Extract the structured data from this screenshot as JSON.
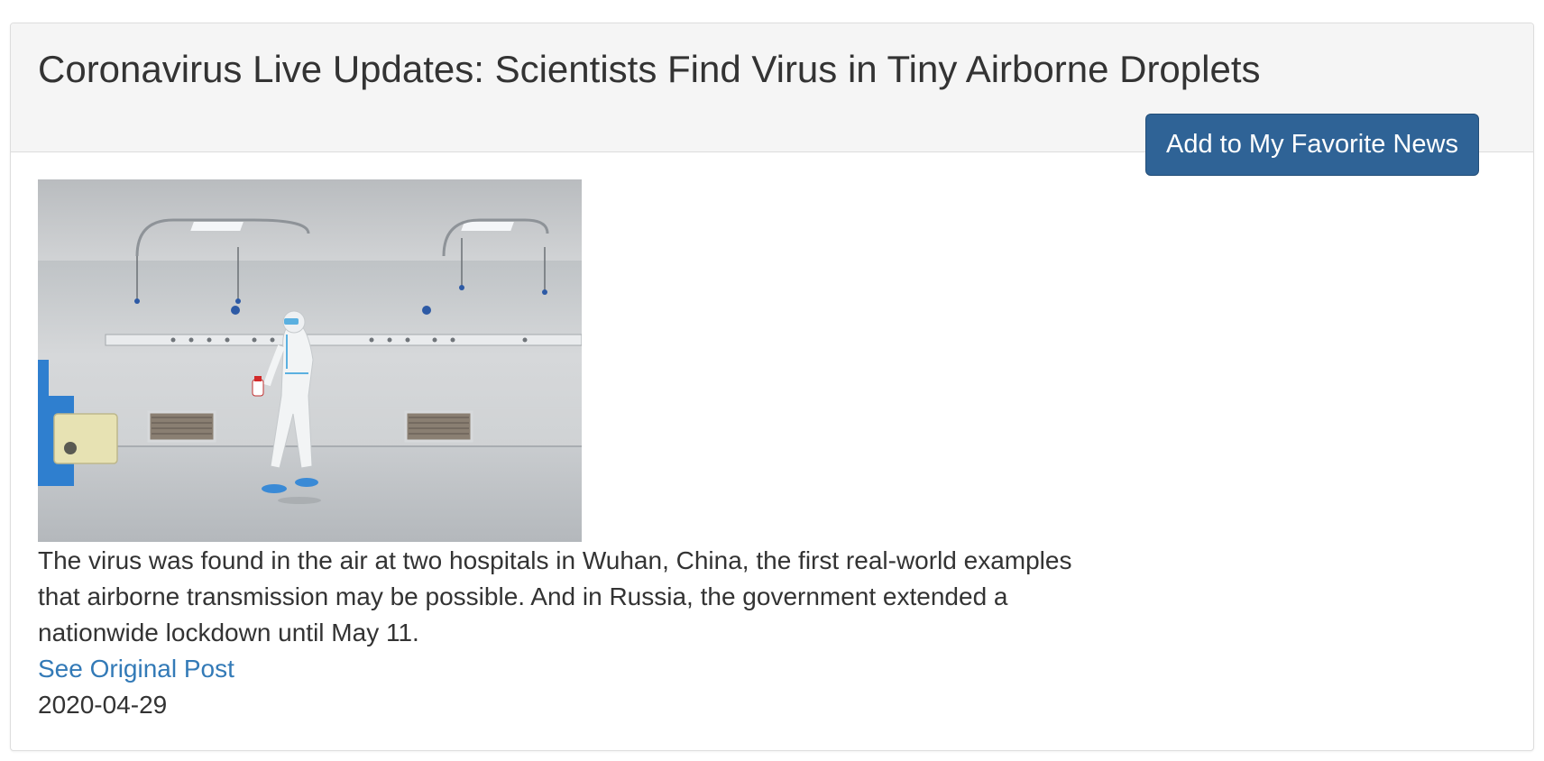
{
  "news": {
    "title": "Coronavirus Live Updates: Scientists Find Virus in Tiny Airborne Droplets",
    "favorite_button_label": "Add to My Favorite News",
    "image_alt": "hospital-ward-worker-photo",
    "description": "The virus was found in the air at two hospitals in Wuhan, China, the first real-world examples that airborne transmission may be possible. And in Russia, the government extended a nationwide lockdown until May 11.",
    "original_link_label": "See Original Post",
    "date": "2020-04-29"
  },
  "colors": {
    "panel_heading_bg": "#f5f5f5",
    "button_bg": "#2f6396",
    "link": "#337ab7",
    "text": "#333333"
  }
}
